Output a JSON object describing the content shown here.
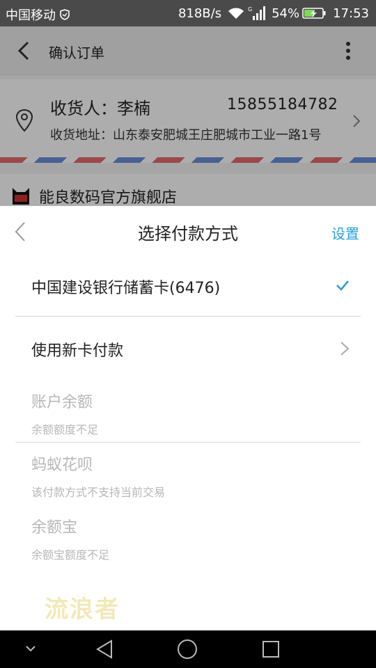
{
  "status_bar": {
    "carrier": "中国移动",
    "net_speed": "818B/s",
    "signal_tag": "G",
    "battery": "54%",
    "time": "17:53"
  },
  "background_page": {
    "title": "确认订单",
    "receiver_label": "收货人：李楠",
    "receiver_phone": "15855184782",
    "address": "收货地址：山东泰安肥城王庄肥城市工业一路1号",
    "store_name": "能良数码官方旗舰店"
  },
  "payment_sheet": {
    "title": "选择付款方式",
    "settings_label": "设置",
    "options": [
      {
        "label": "中国建设银行储蓄卡(6476)",
        "selected": true
      },
      {
        "label": "使用新卡付款",
        "selected": false
      }
    ],
    "disabled_options": [
      {
        "title": "账户余额",
        "subtitle": "余额额度不足"
      },
      {
        "title": "蚂蚁花呗",
        "subtitle": "该付款方式不支持当前交易"
      },
      {
        "title": "余额宝",
        "subtitle": "余额宝额度不足"
      }
    ]
  },
  "watermark": "流浪者",
  "colors": {
    "accent": "#2b9fd9",
    "disabled_text": "#b7b7b7",
    "battery_charging": "#7ed957"
  },
  "icons": [
    "shield-icon",
    "wifi-icon",
    "signal-icon",
    "battery-icon",
    "back-arrow-icon",
    "more-vert-icon",
    "location-pin-icon",
    "chevron-right-icon",
    "tmall-store-icon",
    "check-icon",
    "nav-hide-icon",
    "nav-back-icon",
    "nav-home-icon",
    "nav-recents-icon"
  ]
}
